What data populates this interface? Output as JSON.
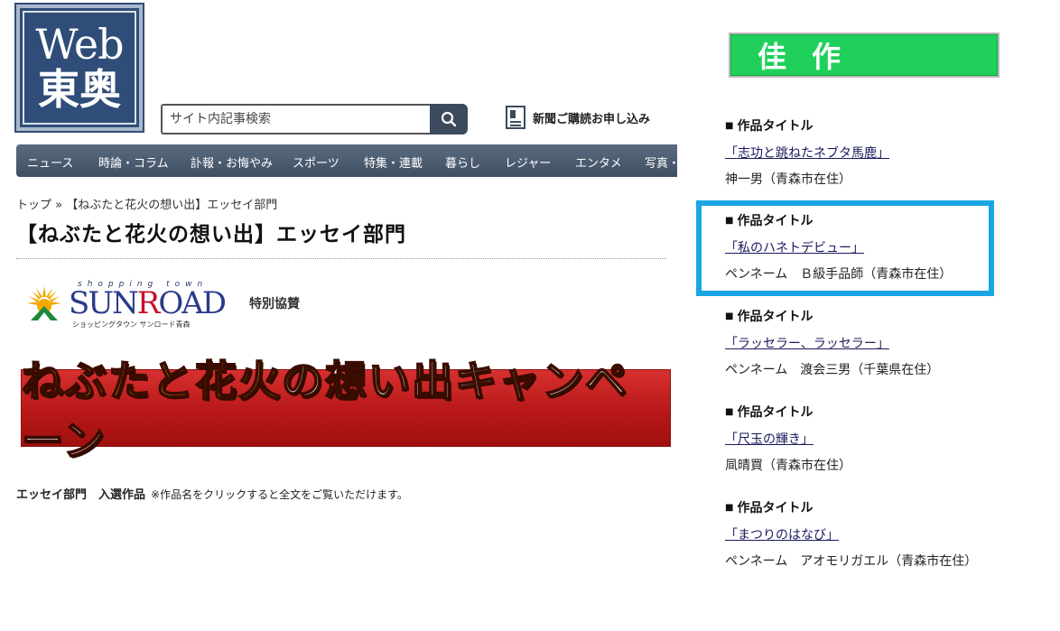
{
  "header": {
    "logo": {
      "line1": "Web",
      "line2": "東奥"
    },
    "search": {
      "placeholder": "サイト内記事検索",
      "value": "",
      "icon": "search-icon"
    },
    "subscribe": {
      "label": "新聞ご購読お申し込み",
      "icon": "newspaper-icon"
    }
  },
  "nav": {
    "items": [
      {
        "label": "ニュース"
      },
      {
        "label": "時論・コラム"
      },
      {
        "label": "訃報・お悔やみ"
      },
      {
        "label": "スポーツ"
      },
      {
        "label": "特集・連載"
      },
      {
        "label": "暮らし"
      },
      {
        "label": "レジャー"
      },
      {
        "label": "エンタメ"
      },
      {
        "label": "写真・"
      }
    ]
  },
  "breadcrumb": {
    "home": "トップ",
    "separator": "»",
    "current": "【ねぶたと花火の想い出】エッセイ部門"
  },
  "page": {
    "title": "【ねぶたと花火の想い出】エッセイ部門",
    "sponsor": {
      "brand_small": "shopping town",
      "brand_name_pre": "SUN",
      "brand_name_r": "R",
      "brand_name_post": "OAD",
      "brand_kana": "ショッピングタウン サンロード青森",
      "label": "特別協賛"
    },
    "banner": {
      "part1": "ねぶたと",
      "part2": "花火",
      "part3": "の想い出キャンペーン"
    },
    "entries_heading": "エッセイ部門　入選作品",
    "entries_note": "※作品名をクリックすると全文をご覧いただけます。"
  },
  "sidebar": {
    "award": "佳作",
    "works": [
      {
        "label": "作品タイトル",
        "title": "「志功と跳ねたネブタ馬鹿」",
        "author": "神一男（青森市在住）"
      },
      {
        "label": "作品タイトル",
        "title": "「私のハネトデビュー」",
        "author": "ペンネーム　Ｂ級手品師（青森市在住）"
      },
      {
        "label": "作品タイトル",
        "title": "「ラッセラー、ラッセラー」",
        "author": "ペンネーム　渡会三男（千葉県在住）"
      },
      {
        "label": "作品タイトル",
        "title": "「尺玉の輝き」",
        "author": "凬晴買（青森市在住）"
      },
      {
        "label": "作品タイトル",
        "title": "「まつりのはなび」",
        "author": "ペンネーム　アオモリガエル（青森市在住）"
      }
    ],
    "highlight_color": "#1aa6e4"
  },
  "colors": {
    "nav_bg": "#4a5a6e",
    "award_green": "#1ed05a",
    "banner_red": "#c41f1f",
    "logo_blue": "#2f4d78"
  }
}
